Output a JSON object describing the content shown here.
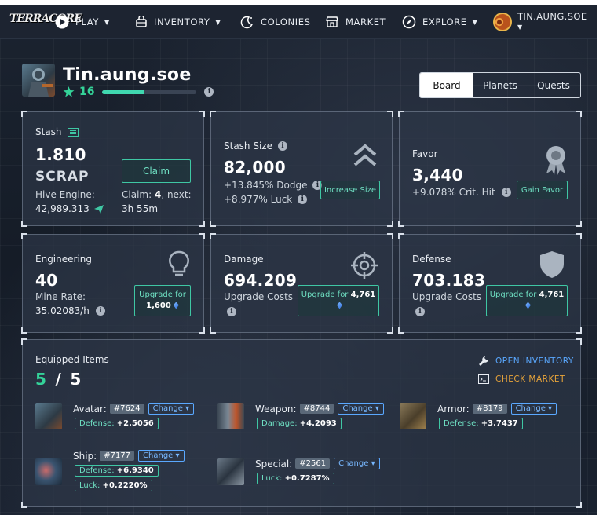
{
  "nav": {
    "logo": "TERRACORE",
    "play": "PLAY",
    "inventory": "INVENTORY",
    "colonies": "COLONIES",
    "market": "MARKET",
    "explore": "EXPLORE",
    "username": "TIN.AUNG.SOE"
  },
  "profile": {
    "name": "Tin.aung.soe",
    "level": "16",
    "xp_progress": 0.45
  },
  "tabs": [
    "Board",
    "Planets",
    "Quests"
  ],
  "stash": {
    "label": "Stash",
    "value": "1.810",
    "unit": "SCRAP",
    "claim_button": "Claim",
    "hive_label": "Hive Engine:",
    "hive_value": "42,989.313",
    "claim_prefix": "Claim: ",
    "claim_count": "4",
    "claim_suffix": ", next:",
    "next_time": "3h 55m"
  },
  "stash_size": {
    "label": "Stash Size",
    "value": "82,000",
    "dodge": "+13.845% Dodge",
    "luck": "+8.977% Luck",
    "button": "Increase Size"
  },
  "favor": {
    "label": "Favor",
    "value": "3,440",
    "crit": "+9.078% Crit. Hit",
    "button": "Gain Favor"
  },
  "engineering": {
    "label": "Engineering",
    "value": "40",
    "mine_label": "Mine Rate:",
    "mine_value": "35.02083/h",
    "button_label": "Upgrade for",
    "button_cost": "1,600"
  },
  "damage": {
    "label": "Damage",
    "value": "694.209",
    "cost_label": "Upgrade Costs",
    "button_label": "Upgrade for",
    "button_cost": "4,761"
  },
  "defense": {
    "label": "Defense",
    "value": "703.183",
    "cost_label": "Upgrade Costs",
    "button_label": "Upgrade for",
    "button_cost": "4,761"
  },
  "equipped": {
    "title": "Equipped Items",
    "count": "5",
    "slash": "/",
    "total": "5",
    "open_inventory": "OPEN INVENTORY",
    "check_market": "CHECK MARKET",
    "change_label": "Change",
    "items": [
      {
        "slot": "Avatar:",
        "id": "#7624",
        "stats": [
          {
            "name": "Defense:",
            "value": "+2.5056"
          }
        ]
      },
      {
        "slot": "Weapon:",
        "id": "#8744",
        "stats": [
          {
            "name": "Damage:",
            "value": "+4.2093"
          }
        ]
      },
      {
        "slot": "Armor:",
        "id": "#8179",
        "stats": [
          {
            "name": "Defense:",
            "value": "+3.7437"
          }
        ]
      },
      {
        "slot": "Ship:",
        "id": "#7177",
        "stats": [
          {
            "name": "Defense:",
            "value": "+6.9340"
          },
          {
            "name": "Luck:",
            "value": "+0.2220%"
          }
        ]
      },
      {
        "slot": "Special:",
        "id": "#2561",
        "stats": [
          {
            "name": "Luck:",
            "value": "+0.7287%"
          }
        ]
      }
    ]
  },
  "colors": {
    "accent": "#3fc7a4",
    "link_blue": "#5aa8ff",
    "link_orange": "#e8a43a",
    "star": "#34d399"
  }
}
